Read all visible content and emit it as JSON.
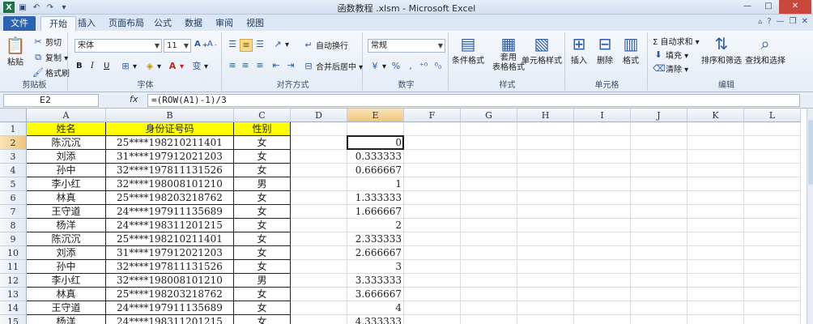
{
  "window": {
    "title": "函数教程 .xlsm - Microsoft Excel",
    "controls": [
      "—",
      "□",
      "✕"
    ]
  },
  "tabs": [
    "文件",
    "开始",
    "插入",
    "页面布局",
    "公式",
    "数据",
    "审阅",
    "视图"
  ],
  "ribbon": {
    "clipboard": {
      "paste": "粘贴",
      "cut": "剪切",
      "copy": "复制 ▾",
      "painter": "格式刷",
      "label": "剪贴板"
    },
    "font": {
      "name": "宋体",
      "size": "11",
      "label": "字体",
      "bold": "B",
      "italic": "I",
      "underline": "U"
    },
    "align": {
      "wrap": "自动换行",
      "merge": "合并后居中 ▾",
      "label": "对齐方式"
    },
    "number": {
      "format": "常规",
      "label": "数字"
    },
    "styles": {
      "cond": "条件格式",
      "table": "套用\n表格格式",
      "cell": "单元格样式",
      "label": "样式"
    },
    "cells": {
      "insert": "插入",
      "delete": "删除",
      "format": "格式",
      "label": "单元格"
    },
    "editing": {
      "autosum": "Σ 自动求和 ▾",
      "fill": "填充 ▾",
      "clear": "清除 ▾",
      "sort": "排序和筛选",
      "find": "查找和选择",
      "label": "编辑"
    }
  },
  "formula_bar": {
    "name_box": "E2",
    "fx": "fx",
    "formula": "=(ROW(A1)-1)/3"
  },
  "sheet": {
    "columns": [
      "A",
      "B",
      "C",
      "D",
      "E",
      "F",
      "G",
      "H",
      "I",
      "J",
      "K",
      "L"
    ],
    "selected_col": "E",
    "selected_row": "2",
    "rows": [
      {
        "n": "1",
        "a": "姓名",
        "b": "身份证号码",
        "c": "性别",
        "e": ""
      },
      {
        "n": "2",
        "a": "陈沉沉",
        "b": "25****198210211401",
        "c": "女",
        "e": "0"
      },
      {
        "n": "3",
        "a": "刘添",
        "b": "31****197912021203",
        "c": "女",
        "e": "0.333333"
      },
      {
        "n": "4",
        "a": "孙中",
        "b": "32****197811131526",
        "c": "女",
        "e": "0.666667"
      },
      {
        "n": "5",
        "a": "李小红",
        "b": "32****198008101210",
        "c": "男",
        "e": "1"
      },
      {
        "n": "6",
        "a": "林真",
        "b": "25****198203218762",
        "c": "女",
        "e": "1.333333"
      },
      {
        "n": "7",
        "a": "王守道",
        "b": "24****197911135689",
        "c": "女",
        "e": "1.666667"
      },
      {
        "n": "8",
        "a": "杨洋",
        "b": "24****198311201215",
        "c": "女",
        "e": "2"
      },
      {
        "n": "9",
        "a": "陈沉沉",
        "b": "25****198210211401",
        "c": "女",
        "e": "2.333333"
      },
      {
        "n": "10",
        "a": "刘添",
        "b": "31****197912021203",
        "c": "女",
        "e": "2.666667"
      },
      {
        "n": "11",
        "a": "孙中",
        "b": "32****197811131526",
        "c": "女",
        "e": "3"
      },
      {
        "n": "12",
        "a": "李小红",
        "b": "32****198008101210",
        "c": "男",
        "e": "3.333333"
      },
      {
        "n": "13",
        "a": "林真",
        "b": "25****198203218762",
        "c": "女",
        "e": "3.666667"
      },
      {
        "n": "14",
        "a": "王守道",
        "b": "24****197911135689",
        "c": "女",
        "e": "4"
      },
      {
        "n": "15",
        "a": "杨洋",
        "b": "24****198311201215",
        "c": "女",
        "e": "4.333333"
      }
    ]
  }
}
